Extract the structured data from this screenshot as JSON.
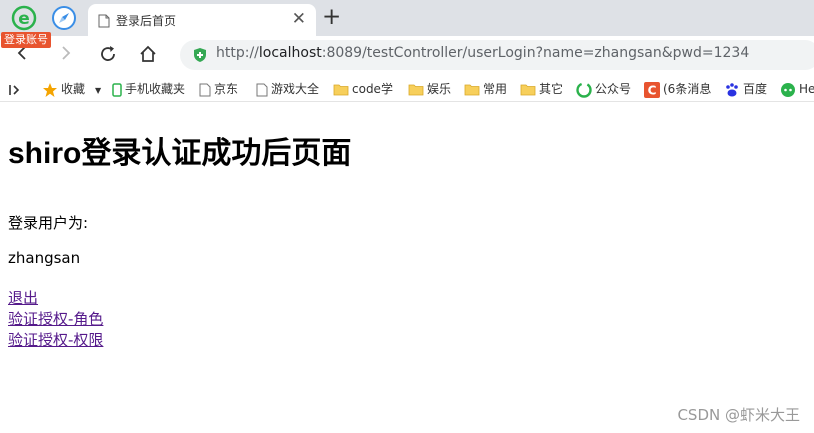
{
  "browser": {
    "login_badge": "登录账号",
    "tab": {
      "title": "登录后首页"
    },
    "address_bar": {
      "scheme": "http://",
      "host": "localhost",
      "rest": ":8089/testController/userLogin?name=zhangsan&pwd=1234"
    },
    "bookmarks": [
      {
        "label": "收藏",
        "icon": "star-icon"
      },
      {
        "label": "手机收藏夹",
        "icon": "phone-icon"
      },
      {
        "label": "京东",
        "icon": "page-icon"
      },
      {
        "label": "游戏大全",
        "icon": "page-icon"
      },
      {
        "label": "code学",
        "icon": "folder-icon"
      },
      {
        "label": "娱乐",
        "icon": "folder-icon"
      },
      {
        "label": "常用",
        "icon": "folder-icon"
      },
      {
        "label": "其它",
        "icon": "folder-icon"
      },
      {
        "label": "公众号",
        "icon": "green-swirl-icon"
      },
      {
        "label": "(6条消息",
        "icon": "csdn-c-icon"
      },
      {
        "label": "百度",
        "icon": "baidu-paw-icon"
      },
      {
        "label": "He",
        "icon": "green-chat-icon"
      }
    ]
  },
  "page": {
    "heading": "shiro登录认证成功后页面",
    "user_label": "登录用户为:",
    "username": "zhangsan",
    "links": {
      "logout": "退出",
      "verify_role": "验证授权-角色",
      "verify_permission": "验证授权-权限"
    }
  },
  "watermark": "CSDN @虾米大王",
  "colors": {
    "tabstrip_bg": "#dee1e6",
    "omnibox_bg": "#f1f3f4",
    "visited_link": "#551a8b",
    "badge_bg": "#e8542f"
  }
}
